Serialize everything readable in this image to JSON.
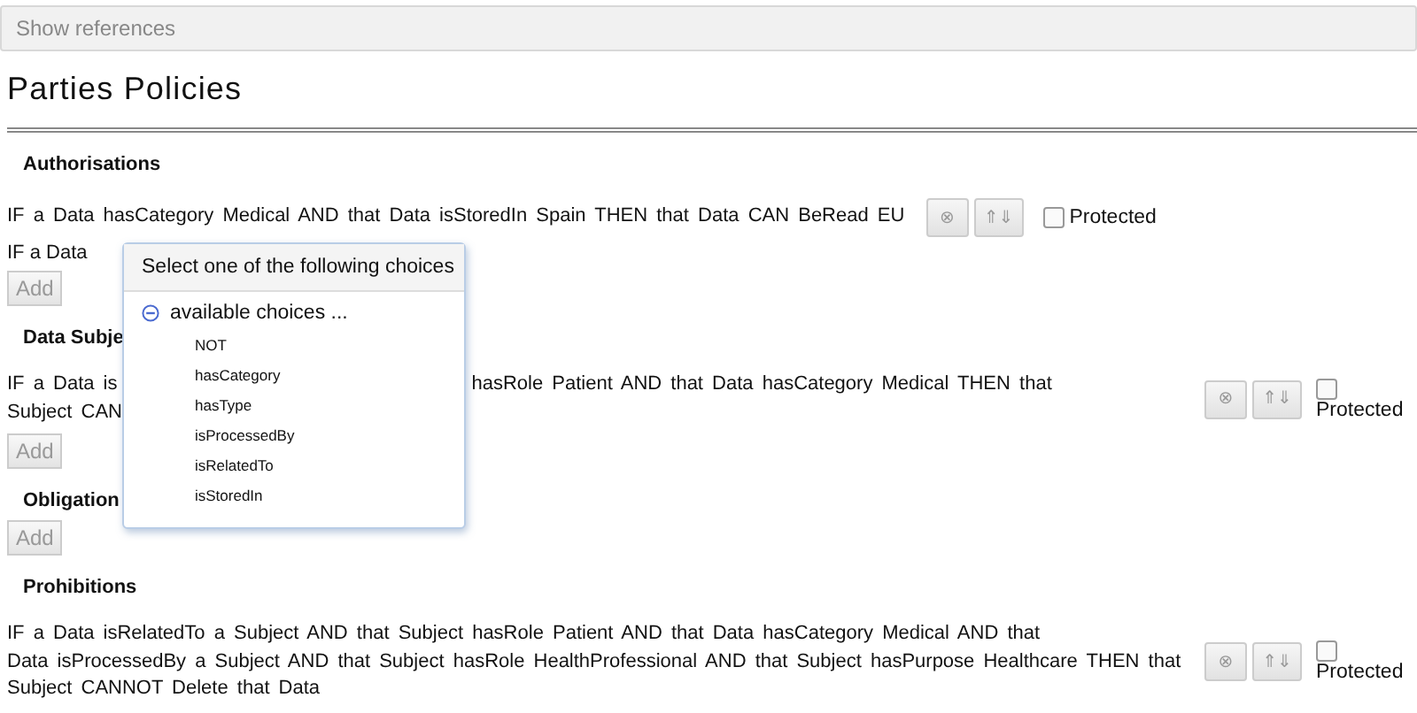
{
  "toolbar": {
    "button": "Show references"
  },
  "title": "Parties Policies",
  "sections": [
    {
      "title": "Authorisations",
      "rules": [
        {
          "kind": "rule",
          "lines": [
            [
              "IF a Data hasCategory Medical AND that Data isStoredIn Spain THEN that Data CAN BeRead EU"
            ]
          ],
          "delete": "⊗",
          "move": "⇑⇓",
          "protected": false,
          "protected_label": "Protected"
        },
        {
          "kind": "editing",
          "lines": [
            [
              "IF a Data"
            ]
          ]
        }
      ],
      "add": "Add"
    },
    {
      "title": "Data Subje",
      "rules": [
        {
          "kind": "rule",
          "lines": [
            [
              "IF a Data is",
              "hasRole Patient AND that Data hasCategory Medical THEN that"
            ],
            [
              "Subject CAN"
            ]
          ],
          "delete": "⊗",
          "move": "⇑⇓",
          "protected": false,
          "protected_label": "Protected"
        }
      ],
      "add": "Add"
    },
    {
      "title": "Obligation",
      "add": "Add"
    },
    {
      "title": "Prohibitions",
      "rules": [
        {
          "kind": "rule",
          "lines": [
            [
              "IF a Data isRelatedTo a Subject AND that Subject hasRole Patient AND that Data hasCategory Medical AND that"
            ],
            [
              "Data isProcessedBy a Subject AND that Subject hasRole HealthProfessional AND that Subject hasPurpose Healthcare THEN that"
            ],
            [
              "Subject CANNOT Delete that Data"
            ]
          ],
          "delete": "⊗",
          "move": "⇑⇓",
          "protected": false,
          "protected_label": "Protected"
        }
      ]
    }
  ],
  "popup": {
    "title": "Select one of the following choices",
    "group": {
      "label": "available choices ...",
      "expanded": true,
      "options": [
        "NOT",
        "hasCategory",
        "hasType",
        "isProcessedBy",
        "isRelatedTo",
        "isStoredIn"
      ]
    }
  }
}
